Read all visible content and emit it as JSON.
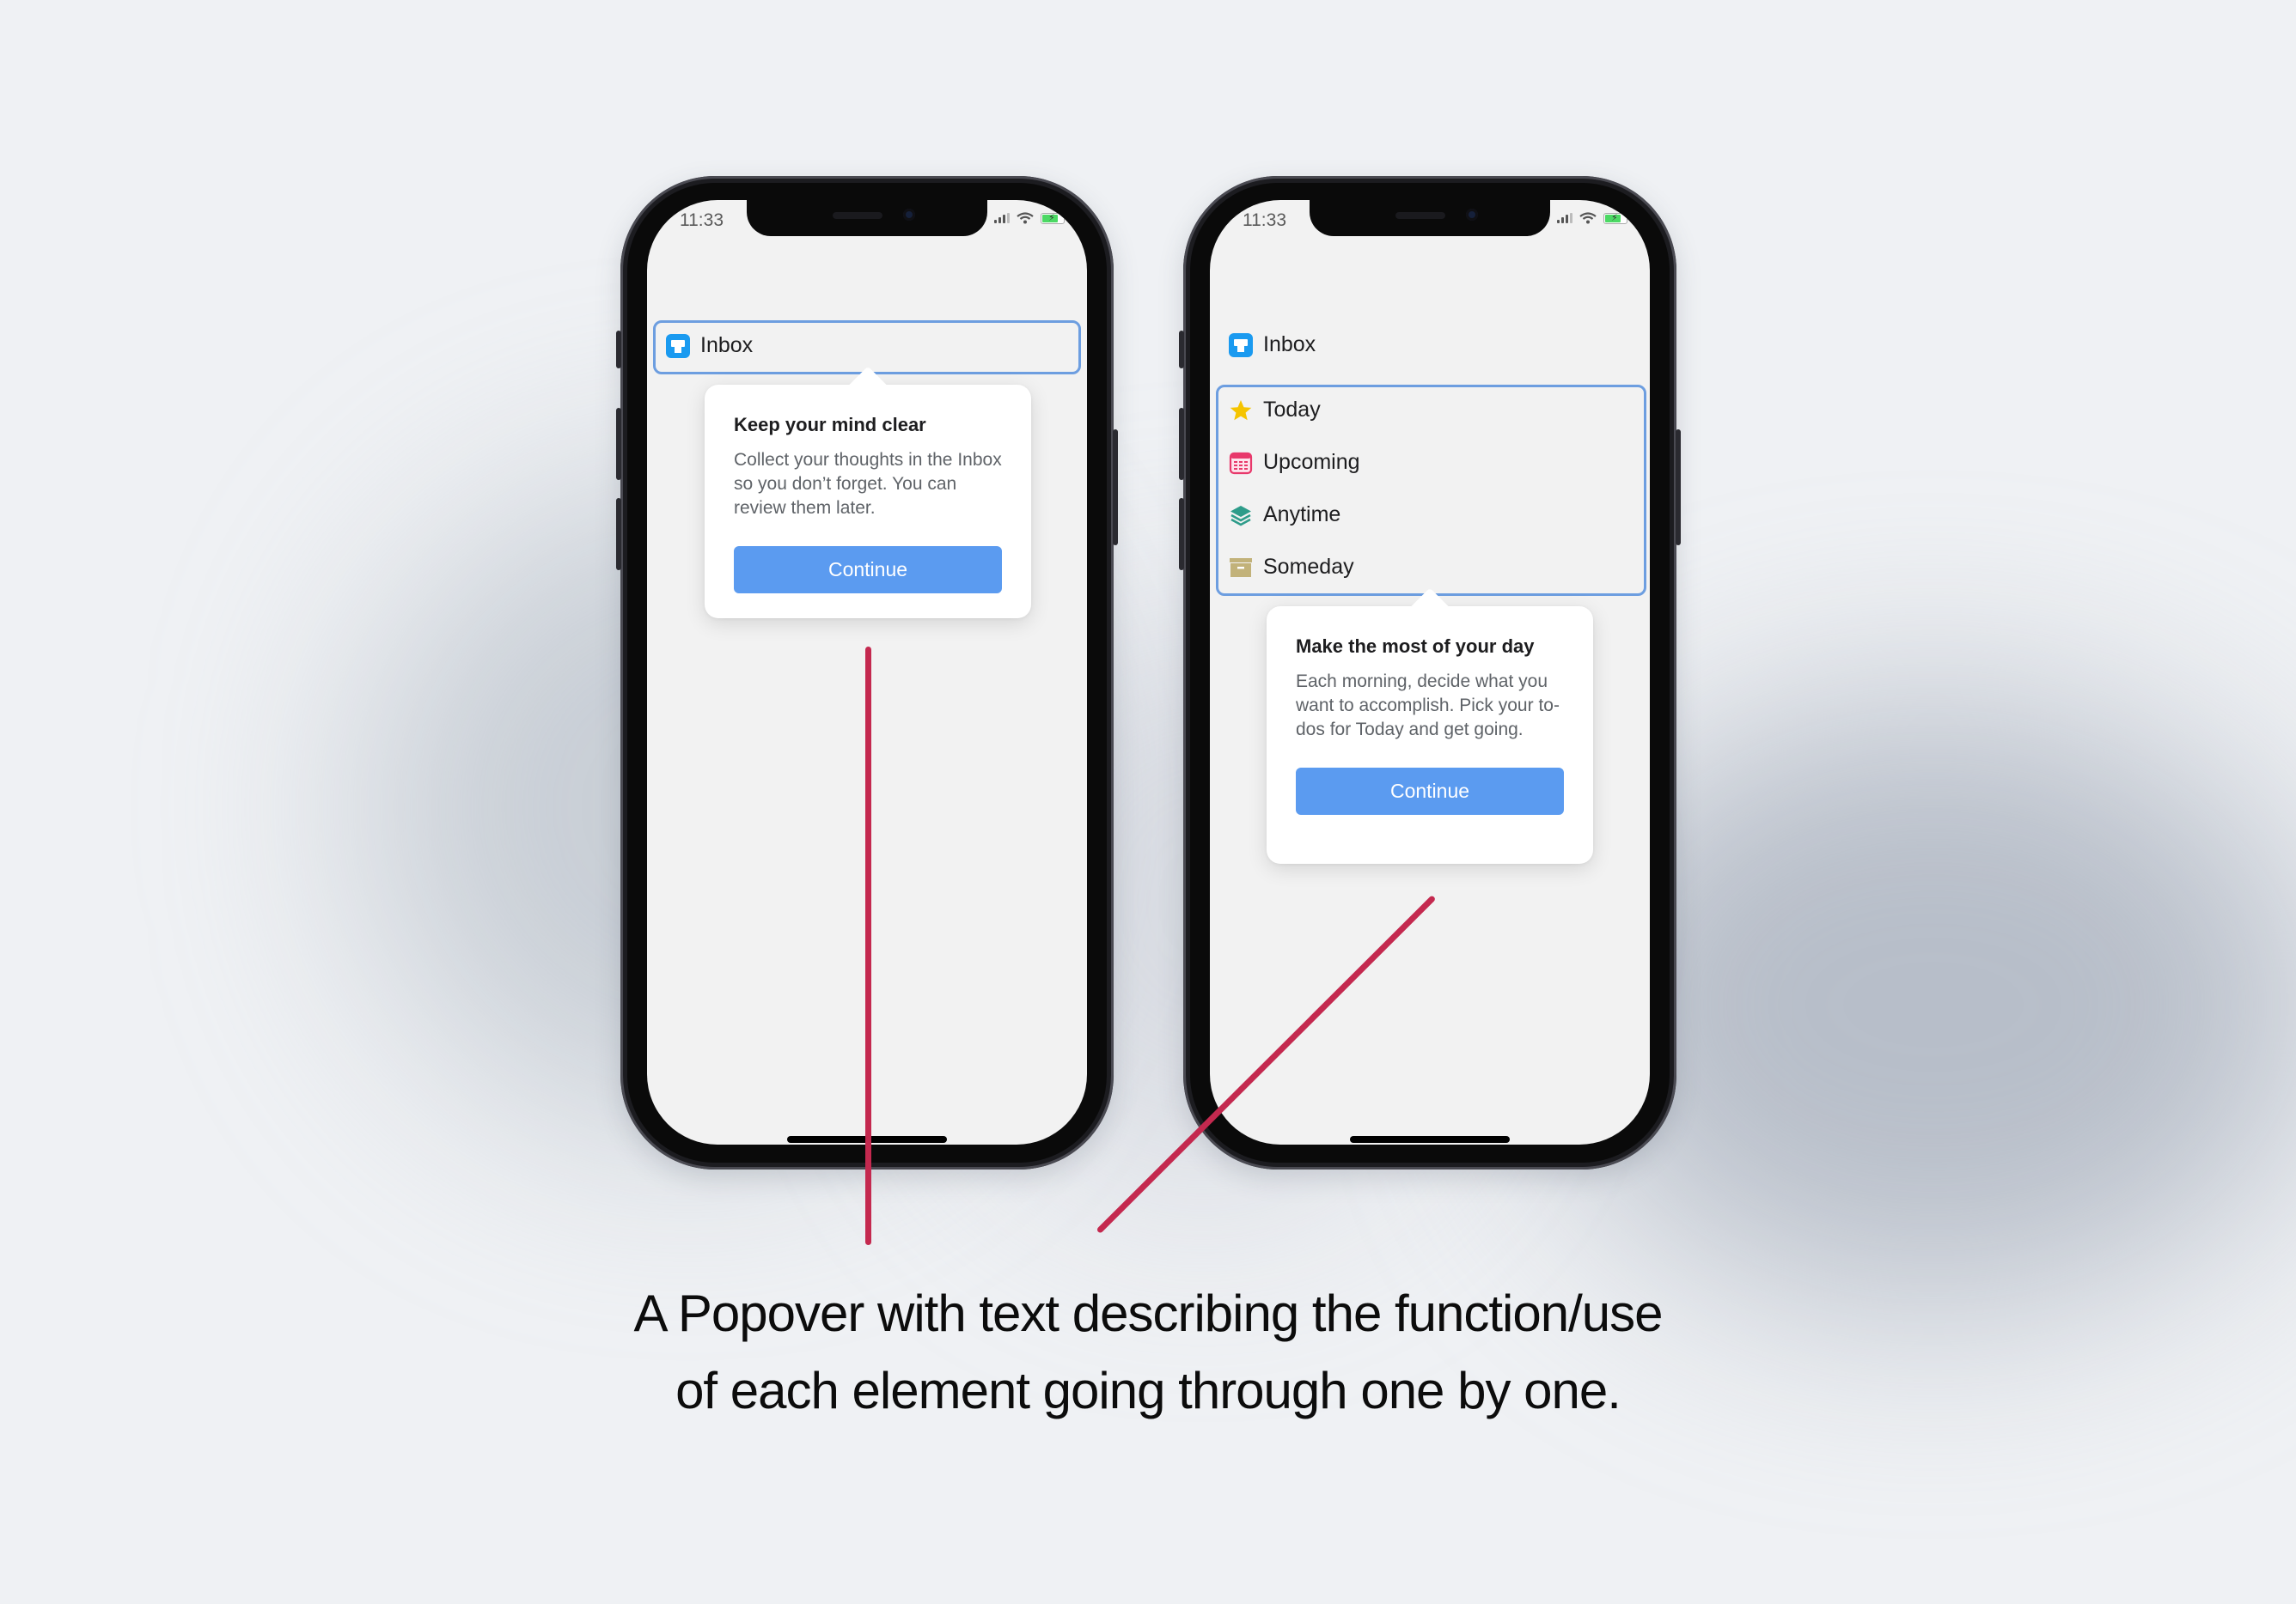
{
  "caption": {
    "line1": "A Popover with text describing the function/use",
    "line2": "of each element going through one by one."
  },
  "colors": {
    "highlight": "#6d9ee0",
    "button": "#5b9bf0",
    "annotation_line": "#c4294f",
    "inbox_icon": "#1a9af0",
    "today_icon": "#f5c400",
    "upcoming_icon": "#e8386b",
    "anytime_icon": "#2e9c8a",
    "someday_icon": "#c2b27a"
  },
  "phones": [
    {
      "status": {
        "time": "11:33",
        "icons": [
          "cellular-signal-icon",
          "wifi-icon",
          "battery-charging-icon"
        ]
      },
      "nav": [
        {
          "label": "Inbox",
          "icon": "inbox-icon"
        }
      ],
      "popover": {
        "title": "Keep your mind clear",
        "body": "Collect your thoughts in the Inbox so you don’t forget. You can review them later.",
        "button": "Continue"
      }
    },
    {
      "status": {
        "time": "11:33",
        "icons": [
          "cellular-signal-icon",
          "wifi-icon",
          "battery-charging-icon"
        ]
      },
      "nav": [
        {
          "label": "Inbox",
          "icon": "inbox-icon"
        },
        {
          "label": "Today",
          "icon": "star-icon"
        },
        {
          "label": "Upcoming",
          "icon": "calendar-icon"
        },
        {
          "label": "Anytime",
          "icon": "layers-icon"
        },
        {
          "label": "Someday",
          "icon": "archive-box-icon"
        }
      ],
      "popover": {
        "title": "Make the most of your day",
        "body": "Each morning, decide what you want to accomplish. Pick your to-dos for Today and get going.",
        "button": "Continue"
      }
    }
  ]
}
